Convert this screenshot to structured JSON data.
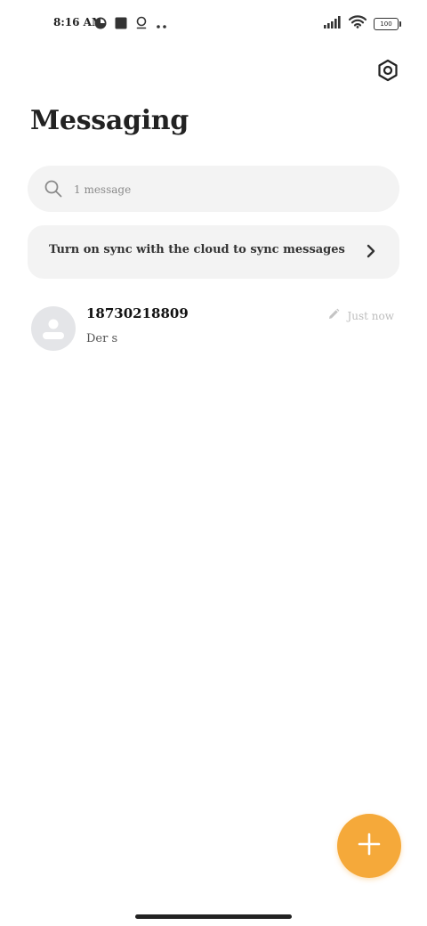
{
  "status_bar": {
    "time": "8:16 AM",
    "battery": "100",
    "left_icons": [
      "pie-status-icon",
      "square-status-icon",
      "location-pin-icon",
      "more-dots-icon"
    ],
    "right_icons": [
      "signal-icon",
      "wifi-icon",
      "battery-icon"
    ]
  },
  "header": {
    "title": "Messaging",
    "settings_icon": "settings-hexagon-icon"
  },
  "search": {
    "placeholder": "1 message",
    "value": ""
  },
  "sync_banner": {
    "text": "Turn on sync with the cloud to sync messages"
  },
  "conversations": [
    {
      "name": "18730218809",
      "snippet": "Der s",
      "time": "Just now",
      "draft_icon": "pencil-icon"
    }
  ],
  "fab": {
    "icon": "plus-icon",
    "color": "#f5a93a"
  }
}
